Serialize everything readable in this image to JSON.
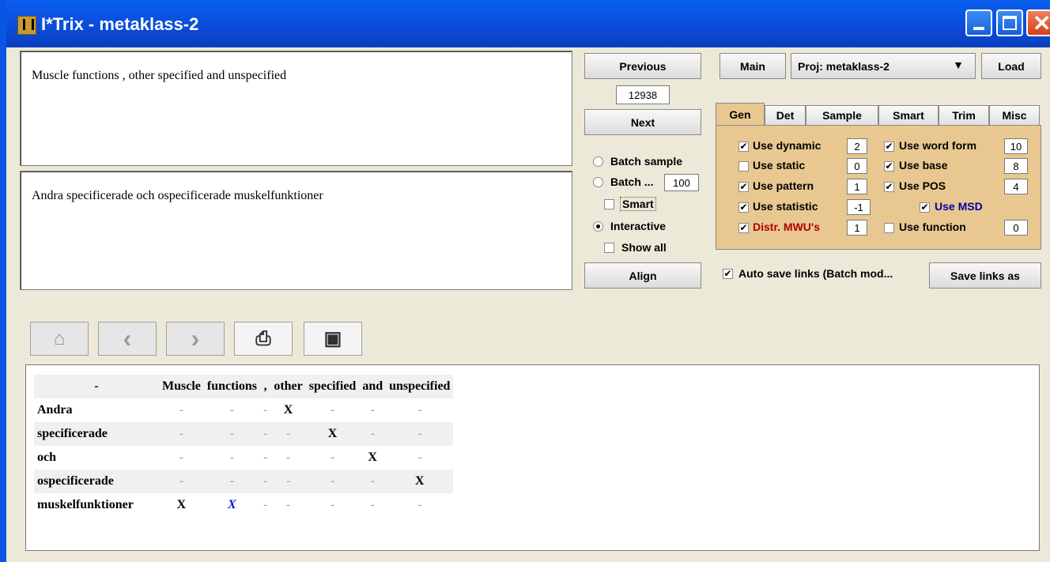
{
  "window": {
    "title": "I*Trix - metaklass-2"
  },
  "source_text": "Muscle functions , other specified and unspecified",
  "target_text": "Andra specificerade och ospecificerade muskelfunktioner",
  "nav": {
    "previous_label": "Previous",
    "index_value": "12938",
    "next_label": "Next",
    "align_label": "Align"
  },
  "mode": {
    "batch_sample_label": "Batch sample",
    "batch_label": "Batch ...",
    "batch_value": "100",
    "smart_label": "Smart",
    "interactive_label": "Interactive",
    "show_all_label": "Show all"
  },
  "project": {
    "main_label": "Main",
    "proj_label": "Proj:",
    "proj_value": "metaklass-2",
    "load_label": "Load"
  },
  "tabs": [
    "Gen",
    "Det",
    "Sample",
    "Smart",
    "Trim",
    "Misc"
  ],
  "gen": {
    "use_dynamic": "Use dynamic",
    "use_dynamic_val": "2",
    "use_static": "Use static",
    "use_static_val": "0",
    "use_pattern": "Use pattern",
    "use_pattern_val": "1",
    "use_statistic": "Use statistic",
    "use_statistic_val": "-1",
    "distr": "Distr. MWU's",
    "distr_val": "1",
    "use_word_form": "Use word form",
    "use_word_form_val": "10",
    "use_base": "Use base",
    "use_base_val": "8",
    "use_pos": "Use POS",
    "use_pos_val": "4",
    "use_msd": "Use MSD",
    "use_function": "Use function",
    "use_function_val": "0"
  },
  "autosave_label": "Auto save links (Batch mod...",
  "save_links_label": "Save links as",
  "check_mark": "✔",
  "toolbar_icons": [
    "home-icon",
    "back-icon",
    "forward-icon",
    "print-icon",
    "save-icon"
  ],
  "toolbar_glyphs": {
    "home": "⌂",
    "back": "‹",
    "forward": "›",
    "print": "⎙",
    "save": "▣"
  },
  "alignment": {
    "corner": "-",
    "columns": [
      "Muscle",
      "functions",
      ",",
      "other",
      "specified",
      "and",
      "unspecified"
    ],
    "rows": [
      {
        "label": "Andra",
        "cells": [
          "-",
          "-",
          "-",
          "X",
          "-",
          "-",
          "-"
        ]
      },
      {
        "label": "specificerade",
        "cells": [
          "-",
          "-",
          "-",
          "-",
          "X",
          "-",
          "-"
        ]
      },
      {
        "label": "och",
        "cells": [
          "-",
          "-",
          "-",
          "-",
          "-",
          "X",
          "-"
        ]
      },
      {
        "label": "ospecificerade",
        "cells": [
          "-",
          "-",
          "-",
          "-",
          "-",
          "-",
          "X"
        ]
      },
      {
        "label": "muskelfunktioner",
        "cells": [
          "X",
          "X",
          "-",
          "-",
          "-",
          "-",
          "-"
        ]
      }
    ],
    "suggested_cell": {
      "row": 4,
      "col": 1
    }
  }
}
